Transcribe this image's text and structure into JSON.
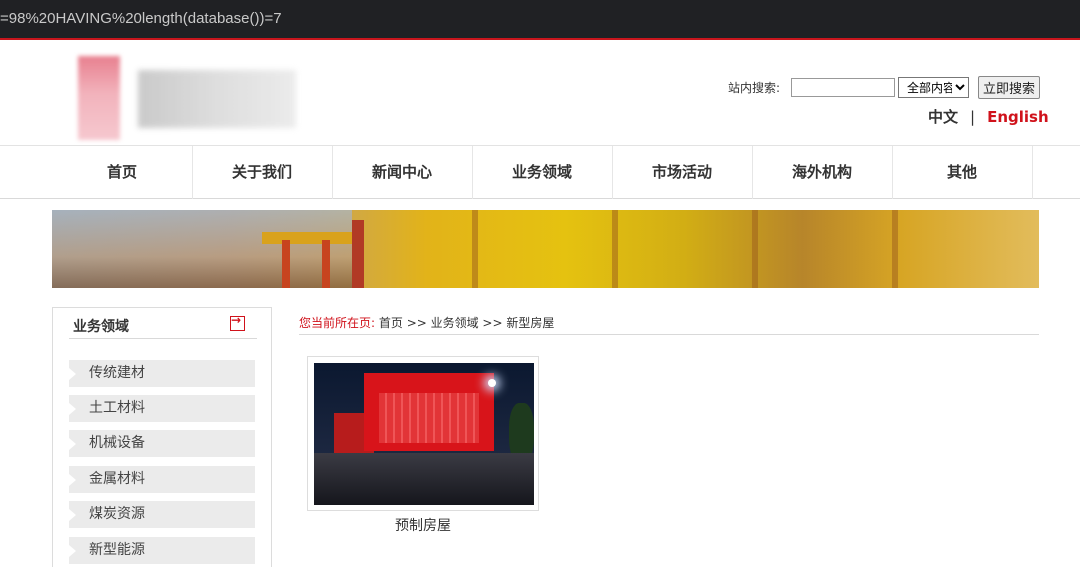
{
  "url_text": "=98%20HAVING%20length(database())=7",
  "header": {
    "search_label": "站内搜索:",
    "search_value": "",
    "search_scope": "全部内容",
    "search_button": "立即搜索",
    "lang_cn": "中文",
    "lang_sep": "|",
    "lang_en": "English"
  },
  "nav": [
    "首页",
    "关于我们",
    "新闻中心",
    "业务领域",
    "市场活动",
    "海外机构",
    "其他"
  ],
  "sidebar": {
    "title": "业务领域",
    "items": [
      "传统建材",
      "土工材料",
      "机械设备",
      "金属材料",
      "煤炭资源",
      "新型能源"
    ]
  },
  "breadcrumb": {
    "label": "您当前所在页:",
    "path": "首页 >> 业务领域 >> 新型房屋"
  },
  "product": {
    "caption": "预制房屋"
  },
  "colors": {
    "accent": "#d0121b",
    "nav_text": "#333333",
    "sidebar_item_bg": "#ebebeb"
  }
}
